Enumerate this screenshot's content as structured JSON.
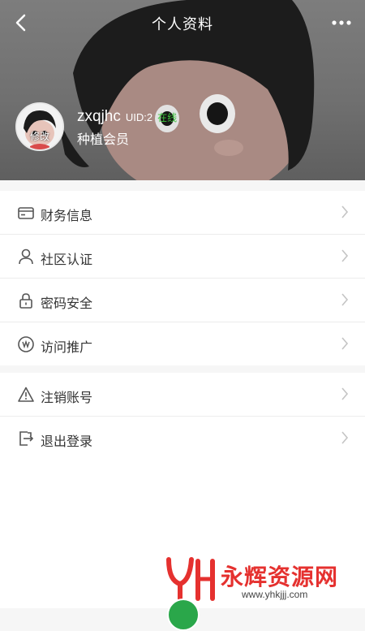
{
  "header": {
    "title": "个人资料",
    "back_icon": "chevron-left-icon",
    "more_icon": "more-dots-icon"
  },
  "profile": {
    "username": "zxqjhc",
    "uid": "UID:2",
    "status": "在线",
    "member_level": "种植会员",
    "avatar_edit": "修改"
  },
  "menu_group_1": [
    {
      "label": "财务信息",
      "icon": "wallet-icon"
    },
    {
      "label": "社区认证",
      "icon": "user-icon"
    },
    {
      "label": "密码安全",
      "icon": "lock-icon"
    },
    {
      "label": "访问推广",
      "icon": "promotion-icon"
    }
  ],
  "menu_group_2": [
    {
      "label": "注销账号",
      "icon": "warning-icon"
    },
    {
      "label": "退出登录",
      "icon": "logout-icon"
    }
  ],
  "watermark": {
    "text": "永辉资源网",
    "url": "www.yhkjjj.com"
  },
  "colors": {
    "status_green": "#3cc13b",
    "watermark_red": "#e5312f"
  }
}
